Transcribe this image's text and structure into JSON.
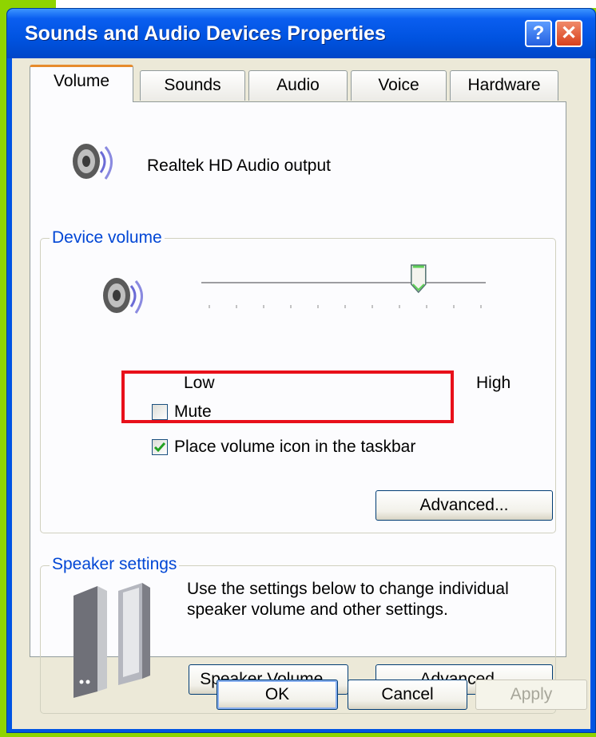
{
  "window": {
    "title": "Sounds and Audio Devices Properties",
    "help_glyph": "?",
    "close_glyph": "✕"
  },
  "tabs": [
    {
      "label": "Volume",
      "active": true
    },
    {
      "label": "Sounds",
      "active": false
    },
    {
      "label": "Audio",
      "active": false
    },
    {
      "label": "Voice",
      "active": false
    },
    {
      "label": "Hardware",
      "active": false
    }
  ],
  "device": {
    "name": "Realtek HD Audio output",
    "icon": "speaker-icon"
  },
  "device_volume": {
    "group_label": "Device volume",
    "low_label": "Low",
    "high_label": "High",
    "level": 0.77,
    "mute_label": "Mute",
    "mute_checked": false,
    "taskbar_label": "Place volume icon in the taskbar",
    "taskbar_checked": true,
    "advanced_label": "Advanced..."
  },
  "speaker_settings": {
    "group_label": "Speaker settings",
    "description_line1": "Use the settings below to change individual",
    "description_line2": "speaker volume and other settings.",
    "speaker_volume_label": "Speaker Volume...",
    "advanced_label": "Advanced..."
  },
  "footer": {
    "ok_label": "OK",
    "cancel_label": "Cancel",
    "apply_label": "Apply"
  },
  "colors": {
    "titlebar": "#0054e3",
    "group_label": "#0046d5",
    "annotation_box": "#e8101a",
    "background": "#8fd400"
  }
}
